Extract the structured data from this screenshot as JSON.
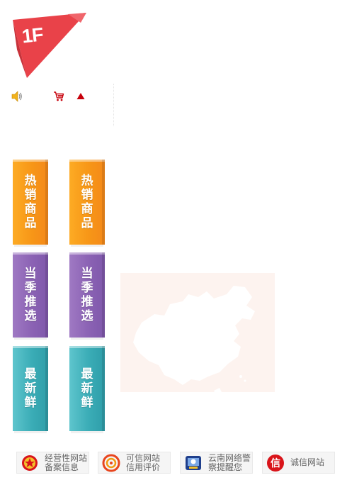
{
  "floor": {
    "label": "1F",
    "color": "#e94249"
  },
  "toolbar": {
    "icons": [
      "speaker-icon",
      "shopping-cart-icon",
      "up-arrow-icon"
    ],
    "accent": "#c7000b"
  },
  "ribbons": {
    "col1": [
      {
        "chars": [
          "热",
          "销",
          "商",
          "品"
        ],
        "color": "#f79617"
      },
      {
        "chars": [
          "当",
          "季",
          "推",
          "选"
        ],
        "color": "#8b62b4"
      },
      {
        "chars": [
          "最",
          "新",
          "鲜"
        ],
        "color": "#3aacb6"
      }
    ],
    "col2": [
      {
        "chars": [
          "热",
          "销",
          "商",
          "品"
        ],
        "color": "#f79617"
      },
      {
        "chars": [
          "当",
          "季",
          "推",
          "选"
        ],
        "color": "#8b62b4"
      },
      {
        "chars": [
          "最",
          "新",
          "鲜"
        ],
        "color": "#3aacb6"
      }
    ]
  },
  "map": {
    "icon": "china-map-icon",
    "background": "#fdf3ef"
  },
  "footer": {
    "badges": [
      {
        "line1": "经营性网站",
        "line2": "备案信息",
        "icon": "police-emblem-icon"
      },
      {
        "line1": "可信网站",
        "line2": "信用评价",
        "icon": "trusted-site-icon"
      },
      {
        "line1": "云南网络警",
        "line2": "察提醒您",
        "icon": "cyber-police-icon"
      },
      {
        "line1": "诚信网站",
        "icon": "integrity-site-icon"
      }
    ]
  }
}
